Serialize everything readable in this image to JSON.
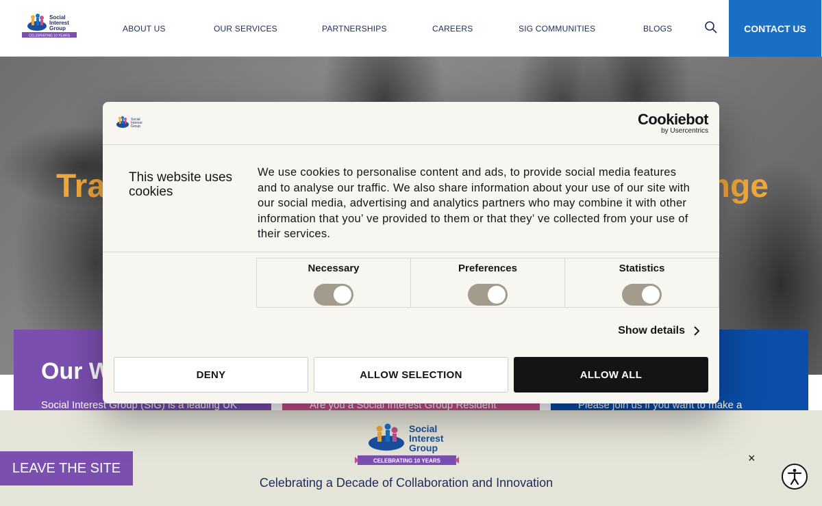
{
  "header": {
    "nav": [
      {
        "label": "ABOUT US"
      },
      {
        "label": "OUR SERVICES"
      },
      {
        "label": "PARTNERSHIPS"
      },
      {
        "label": "CAREERS"
      },
      {
        "label": "SIG COMMUNITIES"
      },
      {
        "label": "BLOGS"
      }
    ],
    "search_icon": "search-icon",
    "contact_label": "CONTACT US",
    "logo_text": [
      "Social",
      "Interest",
      "Group"
    ],
    "logo_ribbon": "CELEBRATING 10 YEARS"
  },
  "hero": {
    "title_left": "Tra",
    "title_right": "nge"
  },
  "cards": [
    {
      "title": "Our W",
      "text": "Social Interest Group (SIG) is a leading UK"
    },
    {
      "title": "",
      "text": "Are you a Social Interest Group Resident"
    },
    {
      "title": "",
      "text": "Please join us if you want to make a"
    }
  ],
  "cookie": {
    "brand": "Cookiebot",
    "brand_by": "by Usercentrics",
    "heading": "This website uses cookies",
    "body": "We use cookies to personalise content and ads, to provide social media features and to analyse our traffic. We also share information about your use of our site with our social media, advertising and analytics partners who may combine it with other information that you’ ve provided to them or that they’ ve collected from your use of their services.",
    "toggles": [
      {
        "label": "Necessary",
        "on": true
      },
      {
        "label": "Preferences",
        "on": true
      },
      {
        "label": "Statistics",
        "on": true
      }
    ],
    "show_details": "Show details",
    "buttons": {
      "deny": "DENY",
      "allow_selection": "ALLOW SELECTION",
      "allow_all": "ALLOW ALL"
    }
  },
  "banner": {
    "logo_text": [
      "Social",
      "Interest",
      "Group"
    ],
    "logo_ribbon": "CELEBRATING 10 YEARS",
    "tagline": "Celebrating a Decade of Collaboration and Innovation",
    "leave_label": "LEAVE THE SITE",
    "close_label": "×",
    "accessibility_icon": "accessibility-icon"
  },
  "colors": {
    "brand_blue": "#1a6fc5",
    "navy": "#1d2b5c",
    "hero_orange": "#f2a83a",
    "purple": "#7b4fb0",
    "pink": "#c44f8f",
    "deep_blue": "#0b4da8",
    "toggle": "#a39b8b"
  }
}
